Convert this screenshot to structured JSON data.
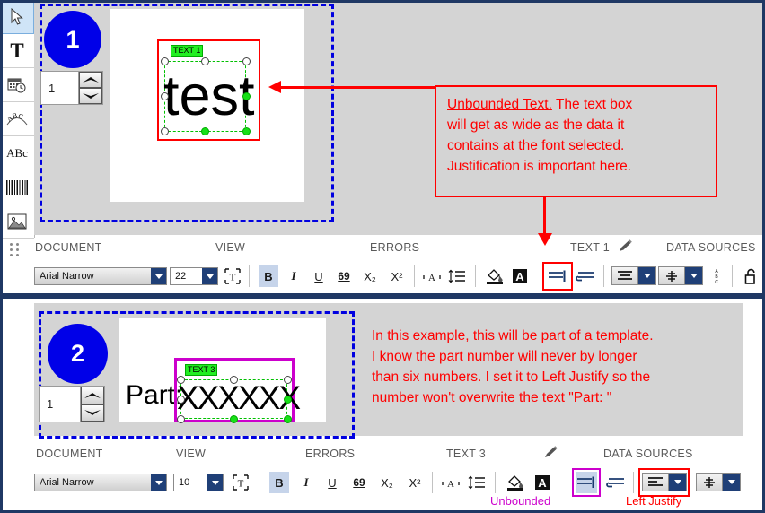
{
  "app": {
    "left_rail": [
      {
        "name": "select-tool",
        "icon": "cursor-arrow-icon",
        "selected": true
      },
      {
        "name": "text-tool",
        "icon": "text-T-icon",
        "selected": false
      },
      {
        "name": "date-time-tool",
        "icon": "calendar-clock-icon",
        "selected": false
      },
      {
        "name": "arc-text-tool",
        "icon": "arc-text-icon",
        "selected": false
      },
      {
        "name": "paragraph-text-tool",
        "icon": "abc-icon",
        "selected": false
      },
      {
        "name": "barcode-tool",
        "icon": "barcode-icon",
        "selected": false
      },
      {
        "name": "image-tool",
        "icon": "picture-icon",
        "selected": false
      }
    ]
  },
  "panel1": {
    "step_number": "1",
    "page_spinner_value": "1",
    "object_tag": "TEXT 1",
    "object_text": "test",
    "callout": {
      "heading": "Unbounded Text.",
      "line1_rest": "  The text box",
      "line2": "will get as wide as the data it",
      "line3": "contains at the font selected.",
      "line4": "Justification is important here."
    },
    "tabs": [
      {
        "label": "DOCUMENT"
      },
      {
        "label": "VIEW"
      },
      {
        "label": "ERRORS"
      },
      {
        "label": "TEXT 1"
      },
      {
        "label": "DATA SOURCES"
      }
    ],
    "tab_pencil_icon": "pencil-icon",
    "toolbar": {
      "font_family": "Arial Narrow",
      "font_size": "22",
      "fit_text_icon": "fit-text-icon",
      "bold": "B",
      "italic": "I",
      "underline": "U",
      "strikethrough": "69",
      "subscript": "X₂",
      "superscript": "X²",
      "char_spacing_icon": "character-spacing-icon",
      "line_spacing_icon": "line-spacing-icon",
      "fill_color_icon": "fill-color-icon",
      "font_color_icon": "font-color-icon",
      "unbounded_icon": "unbounded-text-icon",
      "bounded_icon": "bounded-text-icon",
      "horizontal_align_icon": "horizontal-align-icon",
      "vertical_align_icon": "vertical-align-icon",
      "vertical_text_icon": "vertical-text-abc-icon",
      "lock_icon": "unlock-padlock-icon"
    }
  },
  "panel2": {
    "step_number": "2",
    "page_spinner_value": "1",
    "static_text": "Part:",
    "object_tag": "TEXT 3",
    "object_text": "XXXXXX",
    "callout": {
      "line1": "In this example, this will be part of a template.",
      "line2": "I know the part number will never by longer",
      "line3": "than six numbers.  I set it to Left Justify so the",
      "line4": "number won't overwrite the text \"Part: \""
    },
    "tabs": [
      {
        "label": "DOCUMENT"
      },
      {
        "label": "VIEW"
      },
      {
        "label": "ERRORS"
      },
      {
        "label": "TEXT 3"
      },
      {
        "label": "DATA SOURCES"
      }
    ],
    "tab_pencil_icon": "pencil-icon",
    "toolbar": {
      "font_family": "Arial Narrow",
      "font_size": "10",
      "fit_text_icon": "fit-text-icon",
      "bold": "B",
      "italic": "I",
      "underline": "U",
      "strikethrough": "69",
      "subscript": "X₂",
      "superscript": "X²",
      "char_spacing_icon": "character-spacing-icon",
      "line_spacing_icon": "line-spacing-icon",
      "fill_color_icon": "fill-color-icon",
      "font_color_icon": "font-color-icon",
      "unbounded_icon": "unbounded-text-icon",
      "bounded_icon": "bounded-text-icon",
      "horizontal_align_icon": "horizontal-align-icon",
      "vertical_align_icon": "vertical-align-icon"
    },
    "annotations": {
      "unbounded": "Unbounded",
      "left_justify": "Left Justify"
    }
  },
  "colors": {
    "accent_blue": "#0000e8",
    "ribbon_navy": "#1f3864",
    "callout_red": "#ff0000",
    "magenta": "#cc00cc",
    "tag_green": "#22ee22",
    "canvas_gray": "#d4d4d4"
  }
}
